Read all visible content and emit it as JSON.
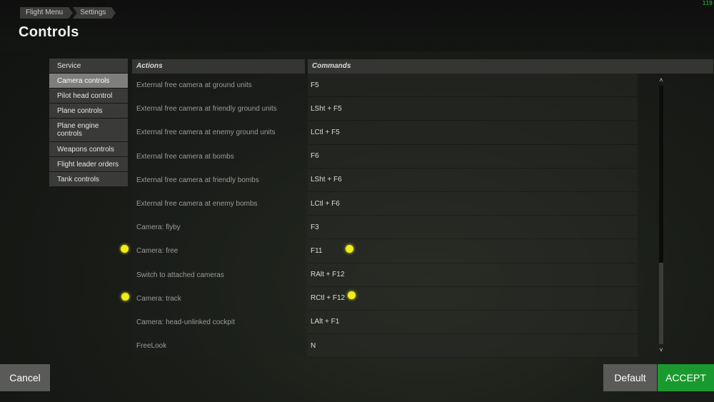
{
  "header": {
    "breadcrumb": [
      "Flight Menu",
      "Settings"
    ],
    "title": "Controls",
    "fps_counter": "119"
  },
  "sidebar": {
    "items": [
      {
        "label": "Service",
        "active": false
      },
      {
        "label": "Camera controls",
        "active": true
      },
      {
        "label": "Pilot head control",
        "active": false
      },
      {
        "label": "Plane controls",
        "active": false
      },
      {
        "label": "Plane engine controls",
        "active": false
      },
      {
        "label": "Weapons controls",
        "active": false
      },
      {
        "label": "Flight leader orders",
        "active": false
      },
      {
        "label": "Tank controls",
        "active": false
      }
    ]
  },
  "table": {
    "columns": [
      "Actions",
      "Commands"
    ],
    "rows": [
      {
        "action": "External free camera at ground units",
        "command": "F5"
      },
      {
        "action": "External free camera at friendly ground units",
        "command": "LSht + F5"
      },
      {
        "action": "External free camera at enemy ground units",
        "command": "LCtl + F5"
      },
      {
        "action": "External free camera at bombs",
        "command": "F6"
      },
      {
        "action": "External free camera at friendly bombs",
        "command": "LSht + F6"
      },
      {
        "action": "External free camera at enemy bombs",
        "command": "LCtl + F6"
      },
      {
        "action": "Camera: flyby",
        "command": "F3"
      },
      {
        "action": "Camera: free",
        "command": "F11"
      },
      {
        "action": "Switch to attached cameras",
        "command": "RAlt + F12"
      },
      {
        "action": "Camera: track",
        "command": "RCtl + F12"
      },
      {
        "action": "Camera: head-unlinked cockpit",
        "command": "LAlt + F1"
      },
      {
        "action": "FreeLook",
        "command": "N"
      }
    ]
  },
  "scrollbar": {
    "up_icon": "chevron-up-icon",
    "down_icon": "chevron-down-icon",
    "up_glyph": "˄",
    "down_glyph": "˅"
  },
  "footer": {
    "cancel_label": "Cancel",
    "default_label": "Default",
    "accept_label": "ACCEPT"
  },
  "colors": {
    "accept": "#1a9a2e",
    "marker": "#f2ec1a",
    "active_tab": "#7e7f7c"
  }
}
